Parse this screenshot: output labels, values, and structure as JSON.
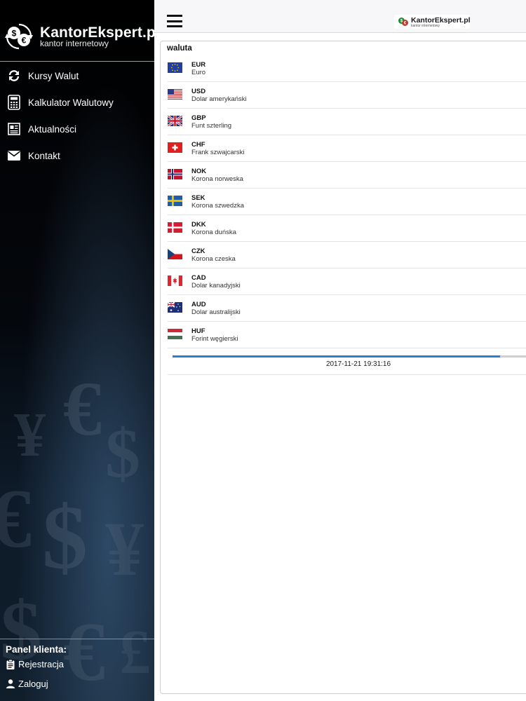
{
  "brand": {
    "name": "KantorEkspert.pl",
    "tagline": "kantor internetowy"
  },
  "menu": [
    {
      "label": "Kursy Walut",
      "icon": "refresh-icon"
    },
    {
      "label": "Kalkulator Walutowy",
      "icon": "calculator-icon"
    },
    {
      "label": "Aktualności",
      "icon": "newspaper-icon"
    },
    {
      "label": "Kontakt",
      "icon": "envelope-icon"
    }
  ],
  "panel": {
    "title": "Panel klienta:",
    "register_label": "Rejestracja",
    "login_label": "Zaloguj"
  },
  "topbar": {
    "menu_icon": "hamburger-icon",
    "logo_name": "KantorEkspert.pl",
    "logo_sub": "kantor internetowy"
  },
  "table": {
    "column_header": "waluta",
    "rows": [
      {
        "code": "EUR",
        "name": "Euro",
        "flag": "eu"
      },
      {
        "code": "USD",
        "name": "Dolar amerykański",
        "flag": "us"
      },
      {
        "code": "GBP",
        "name": "Funt szterling",
        "flag": "gb"
      },
      {
        "code": "CHF",
        "name": "Frank szwajcarski",
        "flag": "ch"
      },
      {
        "code": "NOK",
        "name": "Korona norweska",
        "flag": "no"
      },
      {
        "code": "SEK",
        "name": "Korona szwedzka",
        "flag": "se"
      },
      {
        "code": "DKK",
        "name": "Korona duńska",
        "flag": "dk"
      },
      {
        "code": "CZK",
        "name": "Korona czeska",
        "flag": "cz"
      },
      {
        "code": "CAD",
        "name": "Dolar kanadyjski",
        "flag": "ca"
      },
      {
        "code": "AUD",
        "name": "Dolar australijski",
        "flag": "au"
      },
      {
        "code": "HUF",
        "name": "Forint węgierski",
        "flag": "hu"
      }
    ]
  },
  "refresh": {
    "progress_percent": 91,
    "timestamp": "2017-11-21 19:31:16"
  },
  "colors": {
    "sidebar_bg": "#000000",
    "accent": "#2b7fd3",
    "divider": "#e3e3e3"
  }
}
